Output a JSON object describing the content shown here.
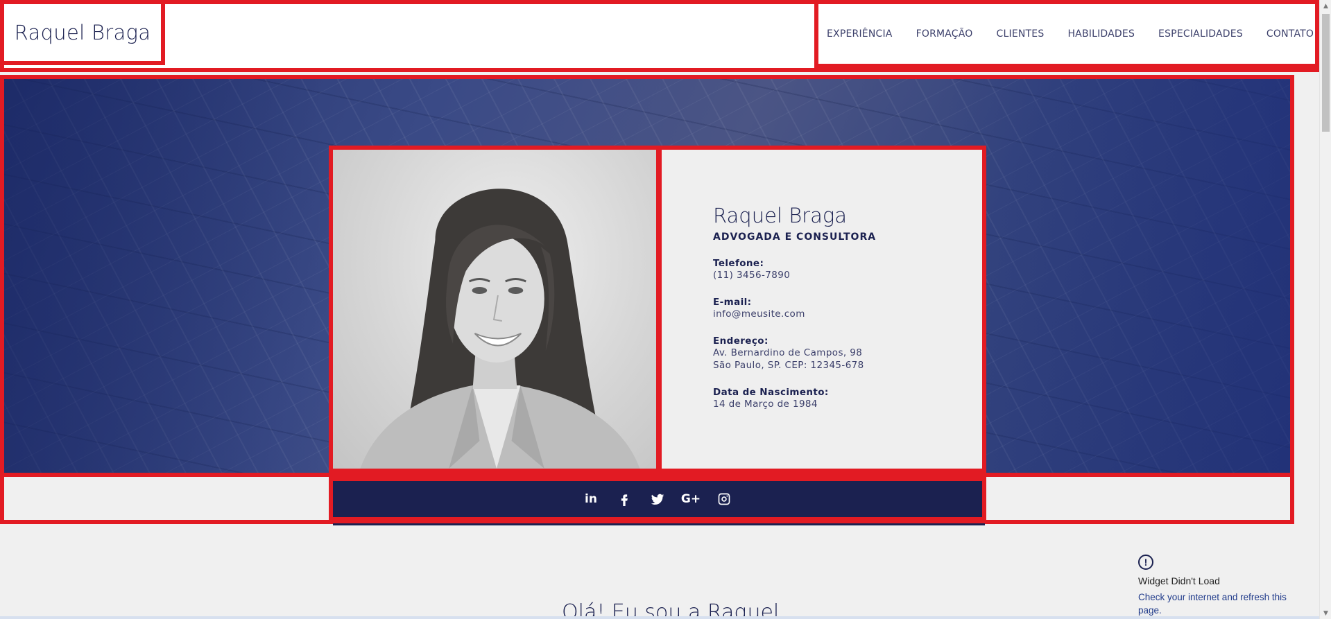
{
  "header": {
    "logo": "Raquel Braga",
    "nav": [
      "EXPERIÊNCIA",
      "FORMAÇÃO",
      "CLIENTES",
      "HABILIDADES",
      "ESPECIALIDADES",
      "CONTATO"
    ]
  },
  "profile": {
    "name": "Raquel Braga",
    "role": "ADVOGADA E CONSULTORA",
    "phone_label": "Telefone:",
    "phone": "(11) 3456-7890",
    "email_label": "E-mail:",
    "email": "info@meusite.com",
    "address_label": "Endereço:",
    "address_line1": "Av. Bernardino de Campos, 98",
    "address_line2": "São Paulo, SP. CEP: 12345-678",
    "birth_label": "Data de Nascimento:",
    "birth": "14 de Março de 1984"
  },
  "social": {
    "icons": [
      "linkedin-icon",
      "facebook-icon",
      "twitter-icon",
      "google-plus-icon",
      "instagram-icon"
    ],
    "linkedin": "in",
    "google_plus": "G+"
  },
  "intro": {
    "heading": "Olá! Eu sou a Raquel"
  },
  "widget": {
    "icon": "!",
    "title": "Widget Didn't Load",
    "subtitle": "Check your internet and refresh this page."
  },
  "colors": {
    "accent_red": "#e21b23",
    "navy": "#1b2150",
    "hero_blue": "#3a4a86",
    "card_bg": "#efefef"
  }
}
